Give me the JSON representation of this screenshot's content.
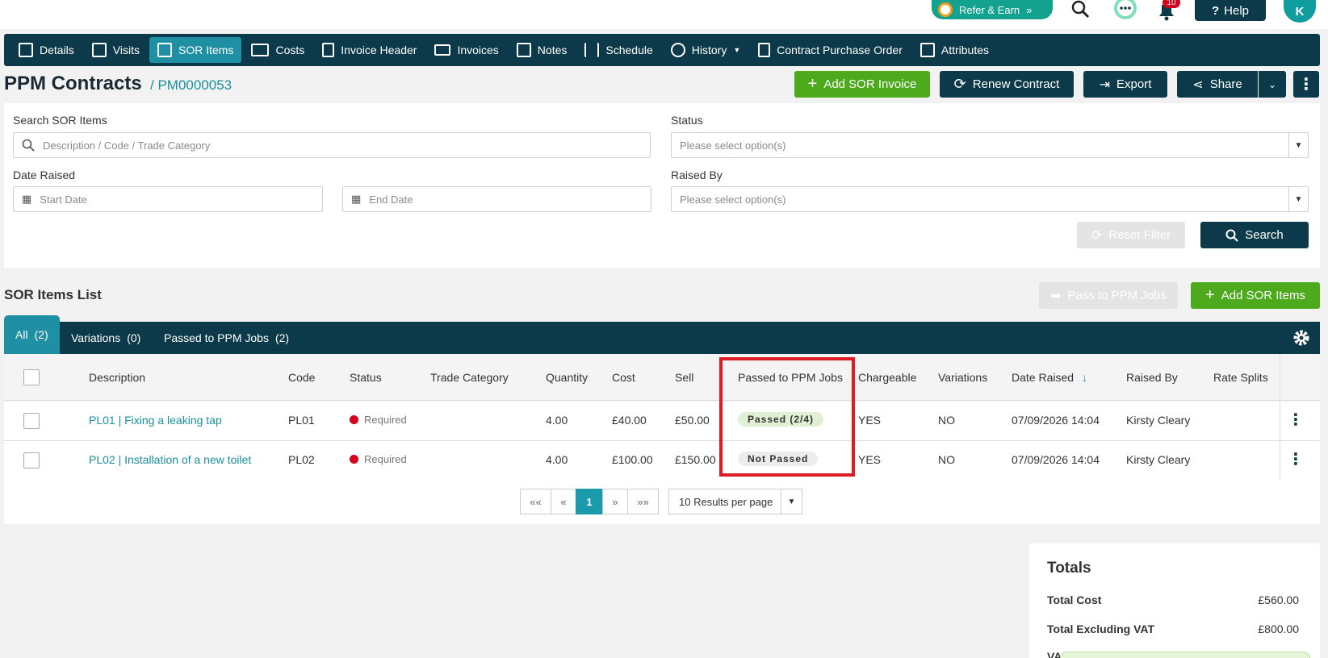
{
  "topbar": {
    "refer_label": "Refer & Earn",
    "refer_chevron": "»",
    "notification_count": "10",
    "help_label": "Help",
    "help_glyph": "?",
    "avatar_initial": "K"
  },
  "nav": {
    "items": [
      {
        "label": "Details",
        "icon": "calendar-check-icon"
      },
      {
        "label": "Visits",
        "icon": "list-icon"
      },
      {
        "label": "SOR Items",
        "icon": "money-icon"
      },
      {
        "label": "Costs",
        "icon": "cash-icon"
      },
      {
        "label": "Invoice Header",
        "icon": "file-icon"
      },
      {
        "label": "Invoices",
        "icon": "card-icon"
      },
      {
        "label": "Notes",
        "icon": "note-icon"
      },
      {
        "label": "Schedule",
        "icon": "sliders-icon"
      },
      {
        "label": "History",
        "icon": "history-icon"
      },
      {
        "label": "Contract Purchase Order",
        "icon": "receipt-icon"
      },
      {
        "label": "Attributes",
        "icon": "code-icon"
      }
    ],
    "active": "SOR Items"
  },
  "header": {
    "title": "PPM Contracts",
    "crumb": "/ PM0000053",
    "add_sor_invoice": "Add SOR Invoice",
    "renew_contract": "Renew Contract",
    "export": "Export",
    "share": "Share"
  },
  "filters": {
    "search_label": "Search SOR Items",
    "search_placeholder": "Description / Code / Trade Category",
    "status_label": "Status",
    "status_placeholder": "Please select option(s)",
    "date_label": "Date Raised",
    "start_placeholder": "Start Date",
    "end_placeholder": "End Date",
    "raised_by_label": "Raised By",
    "raised_by_placeholder": "Please select option(s)",
    "reset_label": "Reset Filter",
    "search_button": "Search"
  },
  "list": {
    "title": "SOR Items List",
    "pass_button": "Pass to PPM Jobs",
    "add_button": "Add SOR Items",
    "tabs": [
      {
        "label": "All",
        "count": "(2)"
      },
      {
        "label": "Variations",
        "count": "(0)"
      },
      {
        "label": "Passed to PPM Jobs",
        "count": "(2)"
      }
    ],
    "columns": [
      "Description",
      "Code",
      "Status",
      "Trade Category",
      "Quantity",
      "Cost",
      "Sell",
      "Passed to PPM Jobs",
      "Chargeable",
      "Variations",
      "Date Raised",
      "Raised By",
      "Rate Splits"
    ],
    "sort_arrow": "↓",
    "rows": [
      {
        "description": "PL01 | Fixing a leaking tap",
        "code": "PL01",
        "status": "Required",
        "trade": "",
        "quantity": "4.00",
        "cost": "£40.00",
        "sell": "£50.00",
        "passed": "Passed (2/4)",
        "chargeable": "YES",
        "variations": "NO",
        "date": "07/09/2026 14:04",
        "raised_by": "Kirsty Cleary",
        "rate_splits": ""
      },
      {
        "description": "PL02 | Installation of a new toilet",
        "code": "PL02",
        "status": "Required",
        "trade": "",
        "quantity": "4.00",
        "cost": "£100.00",
        "sell": "£150.00",
        "passed": "Not Passed",
        "chargeable": "YES",
        "variations": "NO",
        "date": "07/09/2026 14:04",
        "raised_by": "Kirsty Cleary",
        "rate_splits": ""
      }
    ]
  },
  "pagination": {
    "first": "««",
    "prev": "«",
    "page": "1",
    "next": "»",
    "last": "»»",
    "per_page": "10 Results per page"
  },
  "totals": {
    "title": "Totals",
    "total_cost_label": "Total Cost",
    "total_cost": "£560.00",
    "total_ex_vat_label": "Total Excluding VAT",
    "total_ex_vat": "£800.00",
    "vat_label": "VA"
  },
  "colors": {
    "navy": "#0d3a4a",
    "teal": "#1f8fa3",
    "green": "#4caa1c",
    "red": "#e01b24"
  }
}
